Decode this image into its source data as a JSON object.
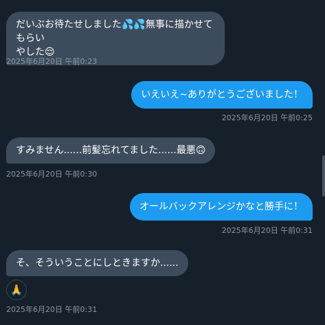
{
  "messages": [
    {
      "side": "received",
      "line1": "だいぶお待たせしました💦💦無事に描かせてもらい",
      "line2": "やした😌",
      "timestamp": "2025年6月20日 午前0:23"
    },
    {
      "side": "sent",
      "text": "いえいえ~ありがとうございました！",
      "timestamp": "2025年6月20日 午前0:25"
    },
    {
      "side": "received",
      "text": "すみません......前髪忘れてました......最悪🙃",
      "timestamp": "2025年6月20日 午前0:30"
    },
    {
      "side": "sent",
      "text": "オールバックアレンジかなと勝手に！",
      "timestamp": "2025年6月20日 午前0:31"
    },
    {
      "side": "received",
      "text": "そ、そういうことにしときますか......",
      "reaction": "🙏",
      "timestamp": "2025年6月20日 午前0:31"
    }
  ],
  "colors": {
    "background": "#15202b",
    "received_bubble": "#3d4c5c",
    "sent_bubble": "#1d9bf0",
    "timestamp": "#8b98a5"
  },
  "icons": {
    "reaction": "folded-hands-icon"
  }
}
